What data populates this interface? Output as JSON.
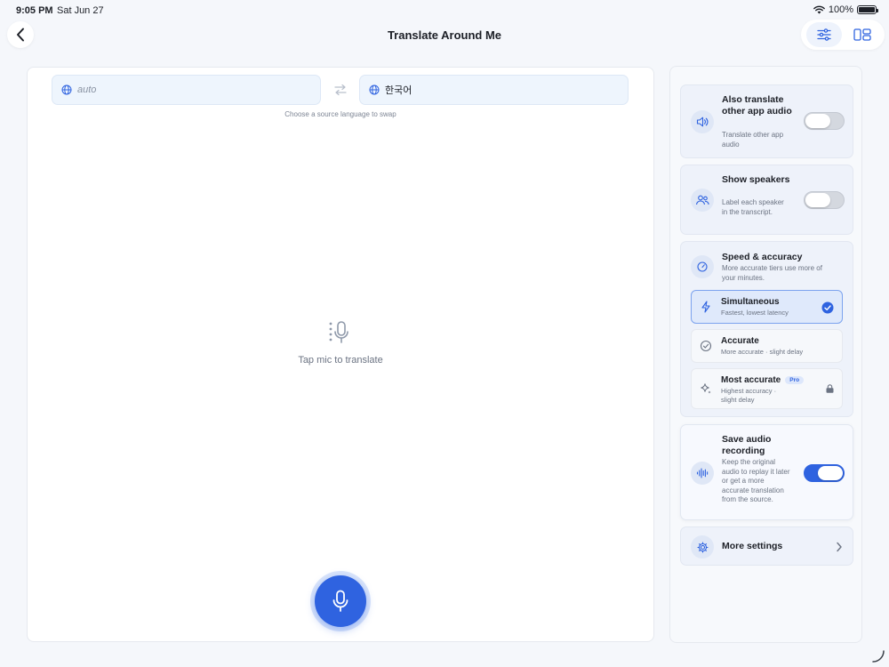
{
  "status": {
    "time": "9:05 PM",
    "date": "Sat Jun 27",
    "battery": "100%"
  },
  "header": {
    "title": "Translate Around Me"
  },
  "languages": {
    "source": "auto",
    "target": "한국어",
    "swap_hint": "Choose a source language to swap"
  },
  "main": {
    "empty_text": "Tap mic to translate"
  },
  "settings": {
    "audio": {
      "title": "Also translate other app audio",
      "desc": "Translate other app audio",
      "enabled": false
    },
    "speakers": {
      "title": "Show speakers",
      "desc": "Label each speaker in the transcript.",
      "enabled": false
    },
    "speed": {
      "title": "Speed & accuracy",
      "desc": "More accurate tiers use more of your minutes.",
      "options": [
        {
          "title": "Simultaneous",
          "desc": "Fastest, lowest latency",
          "selected": true
        },
        {
          "title": "Accurate",
          "desc": "More accurate · slight delay",
          "selected": false
        },
        {
          "title": "Most accurate",
          "badge": "Pro",
          "desc": "Highest accuracy · slight delay",
          "selected": false,
          "locked": true
        }
      ]
    },
    "save": {
      "title": "Save audio recording",
      "desc": "Keep the original audio to replay it later or get a more accurate translation from the source.",
      "enabled": true
    },
    "more": {
      "title": "More settings"
    }
  },
  "colors": {
    "accent": "#2f63e0",
    "background": "#f5f7fb"
  }
}
